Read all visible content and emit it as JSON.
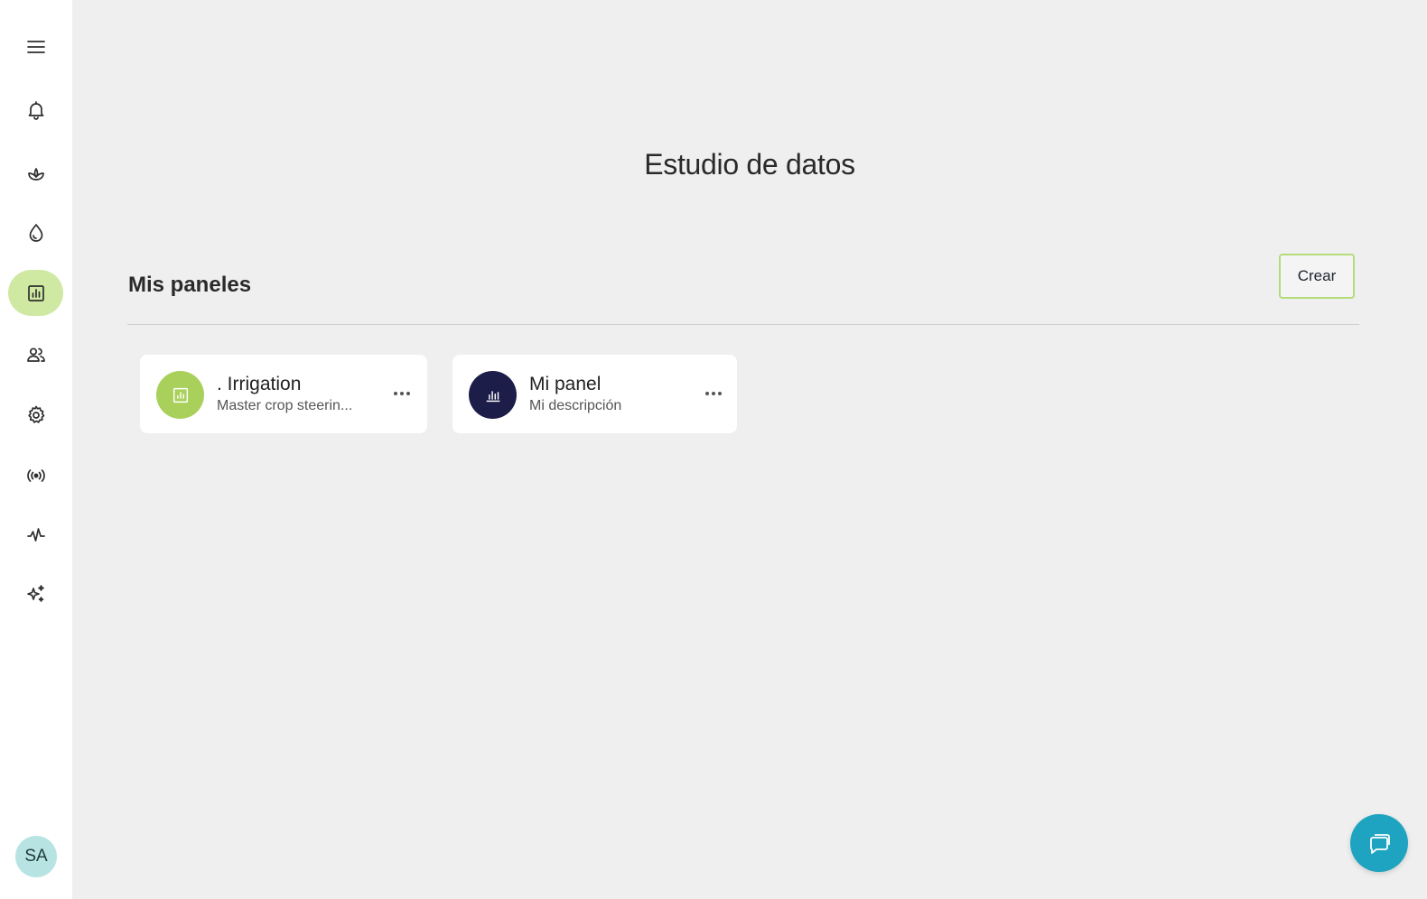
{
  "sidebar": {
    "items": [
      {
        "name": "menu",
        "icon": "menu-icon"
      },
      {
        "name": "notifications",
        "icon": "bell-icon"
      },
      {
        "name": "crops",
        "icon": "plant-icon"
      },
      {
        "name": "irrigation",
        "icon": "drop-icon"
      },
      {
        "name": "data-studio",
        "icon": "bar-chart-icon",
        "active": true
      },
      {
        "name": "users",
        "icon": "users-icon"
      },
      {
        "name": "settings",
        "icon": "gear-icon"
      },
      {
        "name": "sensors",
        "icon": "broadcast-icon"
      },
      {
        "name": "analytics",
        "icon": "pulse-icon"
      },
      {
        "name": "ai",
        "icon": "sparkles-icon"
      }
    ],
    "avatar_initials": "SA"
  },
  "main": {
    "title": "Estudio de datos",
    "section_title": "Mis paneles",
    "create_label": "Crear",
    "dashboards": [
      {
        "title": ". Irrigation",
        "description": "Master crop steerin...",
        "icon": "bar-chart-icon",
        "color": "#a9d05a"
      },
      {
        "title": "Mi panel",
        "description": "Mi descripción",
        "icon": "bar-chart-icon",
        "color": "#1c1d48"
      }
    ]
  },
  "colors": {
    "accent": "#cfe9a3",
    "create_border": "#b6dc7a",
    "chat": "#1ea4c0",
    "avatar": "#b7e3e3"
  },
  "chat": {
    "icon": "chat-icon"
  }
}
